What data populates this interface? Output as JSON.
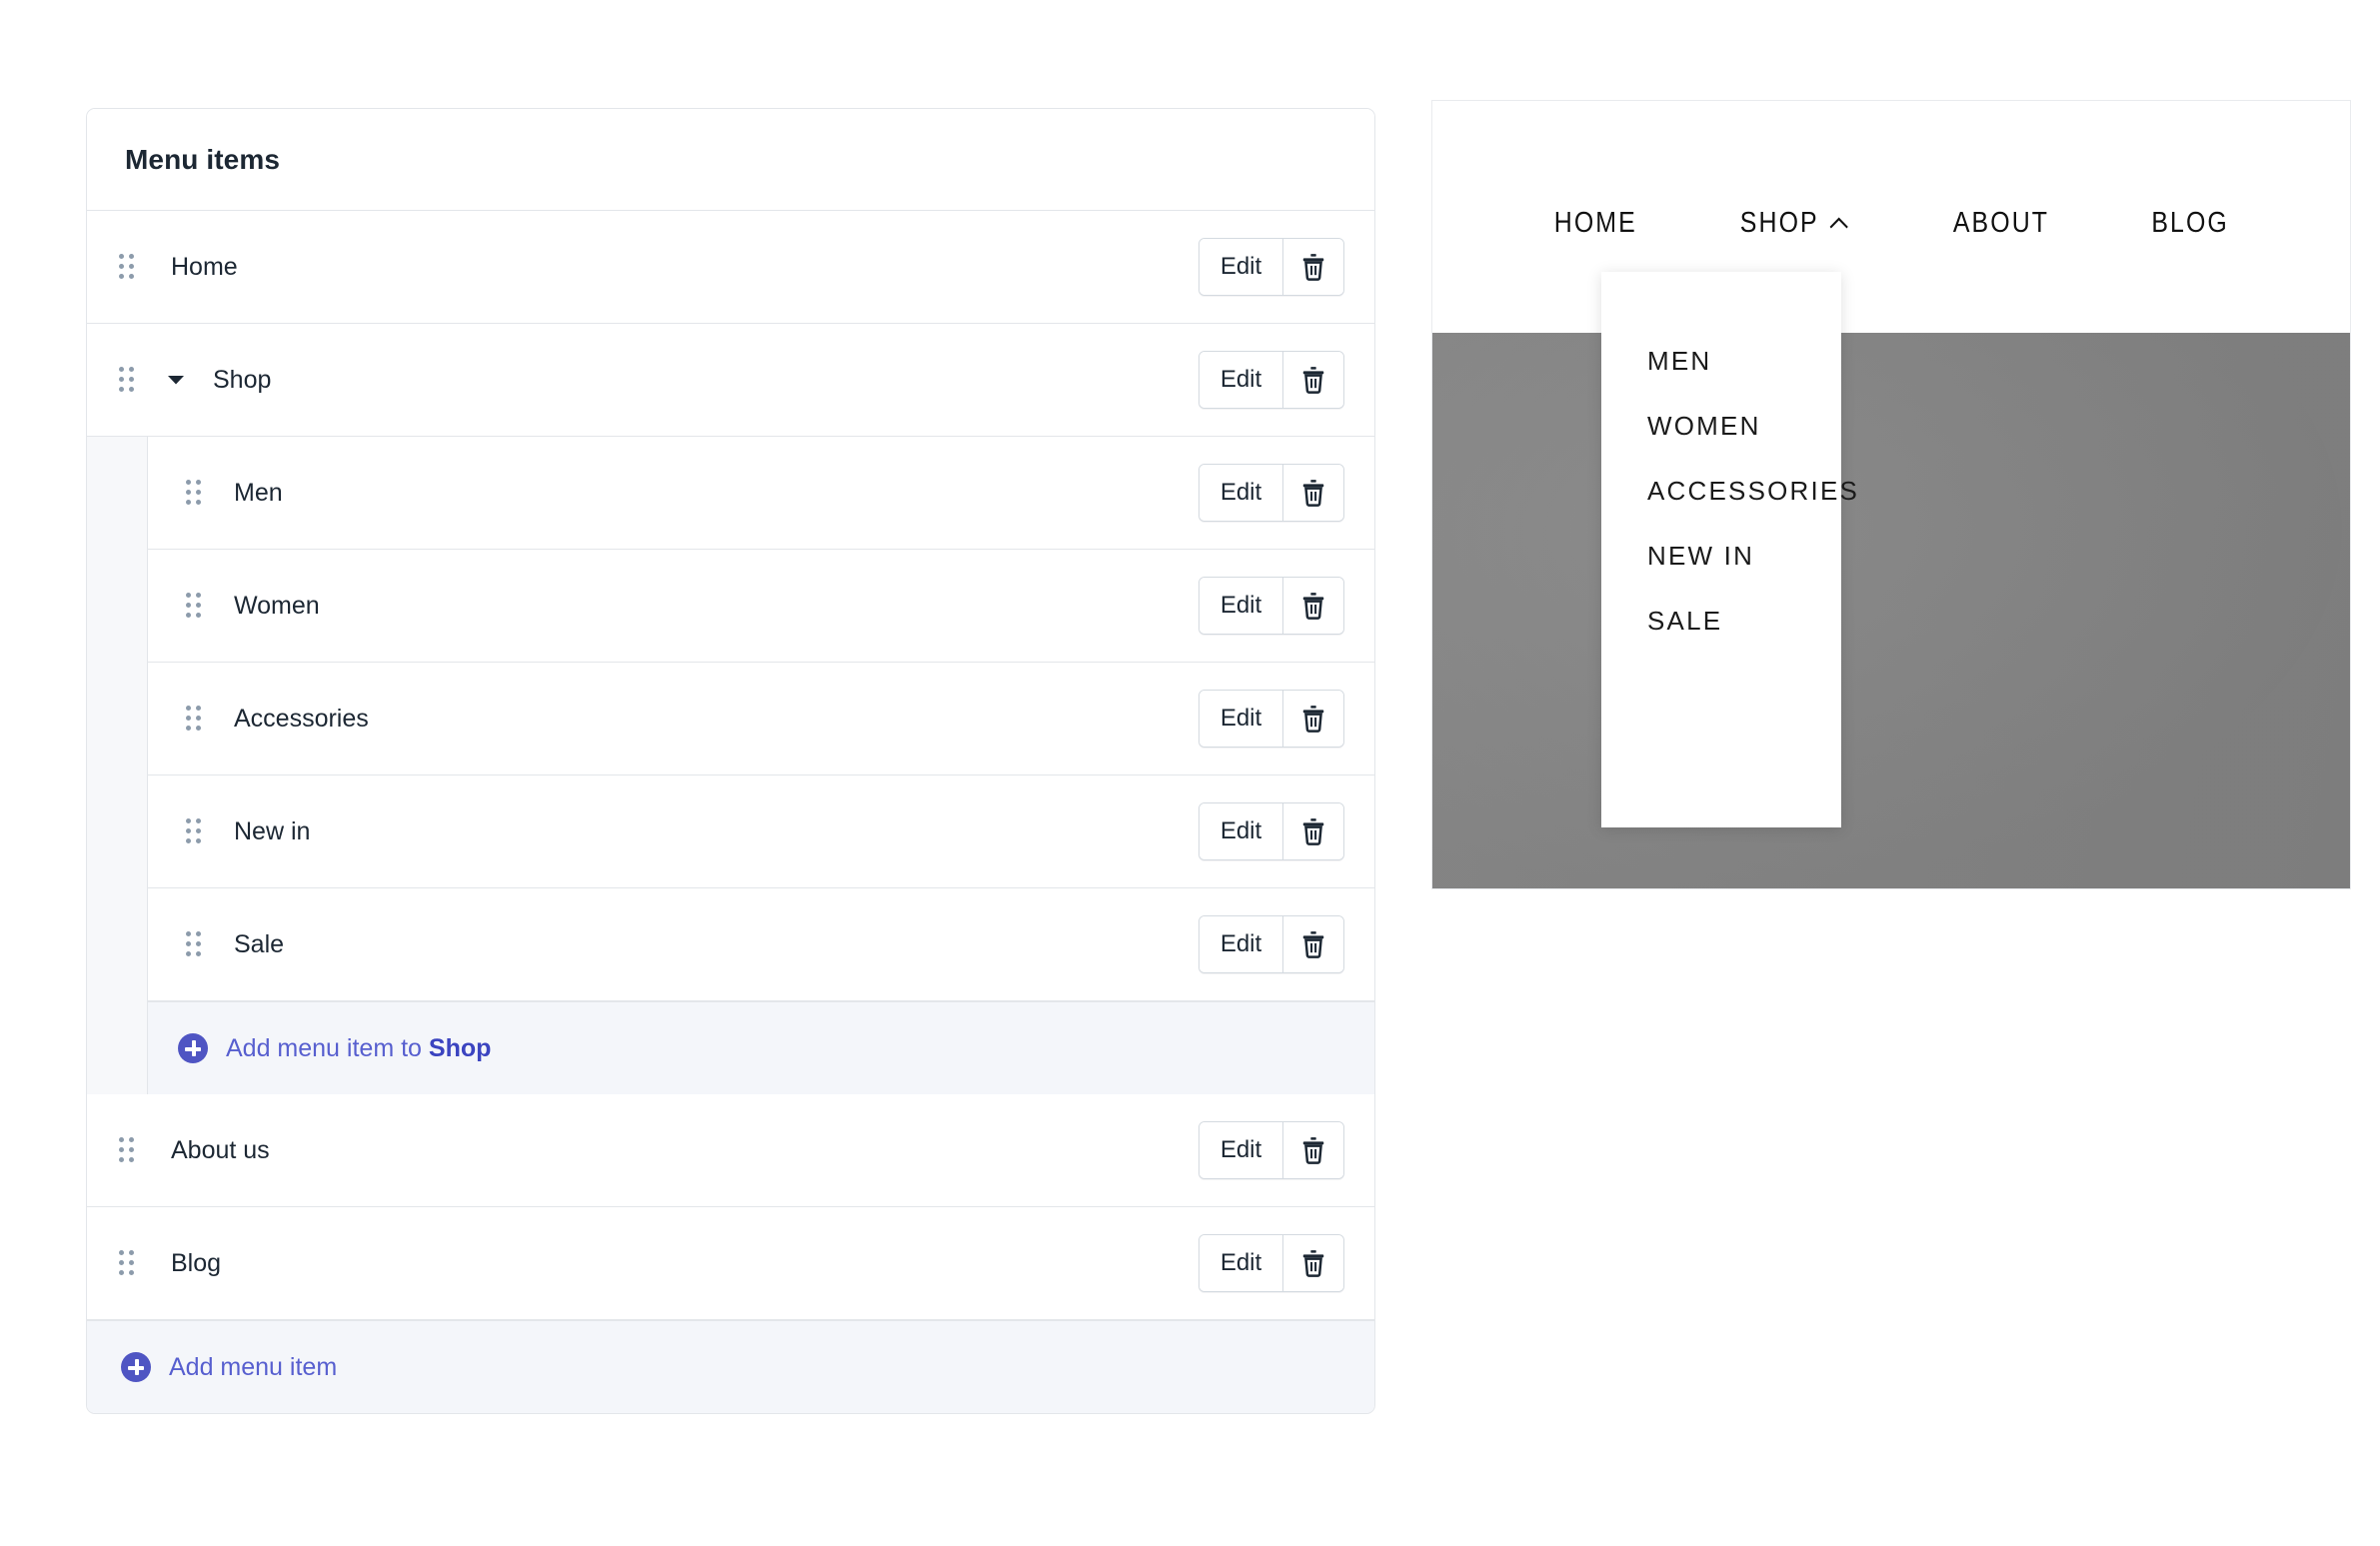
{
  "menu_panel": {
    "title": "Menu items",
    "edit_label": "Edit",
    "delete_icon": "trash-icon",
    "drag_icon": "drag-handle-icon",
    "collapse_icon": "caret-down-icon",
    "add_icon": "plus-circle-icon",
    "accent_color": "#575fcf",
    "items": [
      {
        "label": "Home",
        "level": 0
      },
      {
        "label": "Shop",
        "level": 0,
        "expandable": true,
        "expanded": true
      },
      {
        "label": "Men",
        "level": 1
      },
      {
        "label": "Women",
        "level": 1
      },
      {
        "label": "Accessories",
        "level": 1
      },
      {
        "label": "New in",
        "level": 1
      },
      {
        "label": "Sale",
        "level": 1
      },
      {
        "label": "About us",
        "level": 0
      },
      {
        "label": "Blog",
        "level": 0
      }
    ],
    "child_add": {
      "prefix": "Add menu item to ",
      "target": "Shop"
    },
    "footer_add": {
      "label": "Add menu item"
    }
  },
  "preview": {
    "nav": [
      {
        "label": "HOME",
        "has_caret": false
      },
      {
        "label": "SHOP",
        "has_caret": true,
        "caret": "chevron-up-icon"
      },
      {
        "label": "ABOUT",
        "has_caret": false
      },
      {
        "label": "BLOG",
        "has_caret": false
      }
    ],
    "dropdown": {
      "items": [
        "MEN",
        "WOMEN",
        "ACCESSORIES",
        "NEW IN",
        "SALE"
      ]
    },
    "hero_color": "#838383"
  }
}
